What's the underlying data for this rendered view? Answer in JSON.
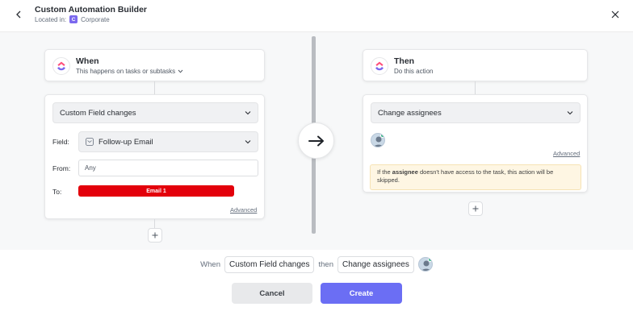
{
  "header": {
    "title": "Custom Automation Builder",
    "location_label": "Located in:",
    "space_initial": "C",
    "space_name": "Corporate"
  },
  "trigger": {
    "title": "When",
    "subtitle": "This happens on tasks or subtasks",
    "event_select": "Custom Field changes",
    "field_label": "Field:",
    "field_value": "Follow-up Email",
    "from_label": "From:",
    "from_value": "Any",
    "to_label": "To:",
    "to_value": "Email 1",
    "advanced_label": "Advanced"
  },
  "action": {
    "title": "Then",
    "subtitle": "Do this action",
    "action_select": "Change assignees",
    "advanced_label": "Advanced",
    "warning_prefix": "If the",
    "warning_bold": "assignee",
    "warning_suffix": "doesn't have access to the task, this action will be skipped."
  },
  "summary": {
    "when_word": "When",
    "trigger_chip": "Custom Field changes",
    "then_word": "then",
    "action_chip": "Change assignees"
  },
  "footer": {
    "cancel_label": "Cancel",
    "create_label": "Create"
  },
  "colors": {
    "accent": "#6b6ef4",
    "red_tag": "#e3000b",
    "space_badge": "#7b68ee"
  }
}
